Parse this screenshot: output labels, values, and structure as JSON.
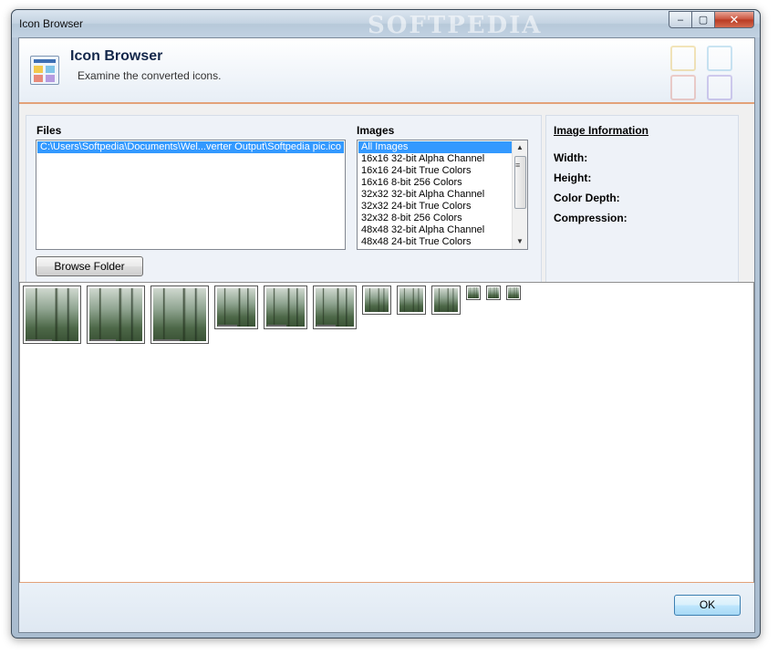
{
  "window": {
    "title": "Icon Browser",
    "watermark": "SOFTPEDIA",
    "caption_buttons": {
      "minimize": "–",
      "maximize": "▢",
      "close": "✕"
    }
  },
  "header": {
    "title": "Icon Browser",
    "subtitle": "Examine the converted icons."
  },
  "files": {
    "label": "Files",
    "items": [
      "C:\\Users\\Softpedia\\Documents\\Wel...verter Output\\Softpedia pic.ico"
    ],
    "selected_index": 0
  },
  "images": {
    "label": "Images",
    "items": [
      "All Images",
      "16x16 32-bit Alpha Channel",
      "16x16 24-bit True Colors",
      "16x16 8-bit 256 Colors",
      "32x32 32-bit Alpha Channel",
      "32x32 24-bit True Colors",
      "32x32 8-bit 256 Colors",
      "48x48 32-bit Alpha Channel",
      "48x48 24-bit True Colors"
    ],
    "selected_index": 0
  },
  "browse_button": {
    "label": "Browse Folder"
  },
  "image_information": {
    "title": "Image Information",
    "width_label": "Width:",
    "height_label": "Height:",
    "color_depth_label": "Color Depth:",
    "compression_label": "Compression:"
  },
  "thumbnails": {
    "count": 12,
    "sizes_px": [
      "large",
      "large",
      "large",
      "medium",
      "medium",
      "medium",
      "small",
      "small",
      "small",
      "tiny",
      "tiny",
      "tiny"
    ]
  },
  "footer": {
    "ok_label": "OK"
  },
  "colors": {
    "accent_orange": "#e3a178",
    "selection_blue": "#3399ff",
    "title_navy": "#13274a"
  }
}
